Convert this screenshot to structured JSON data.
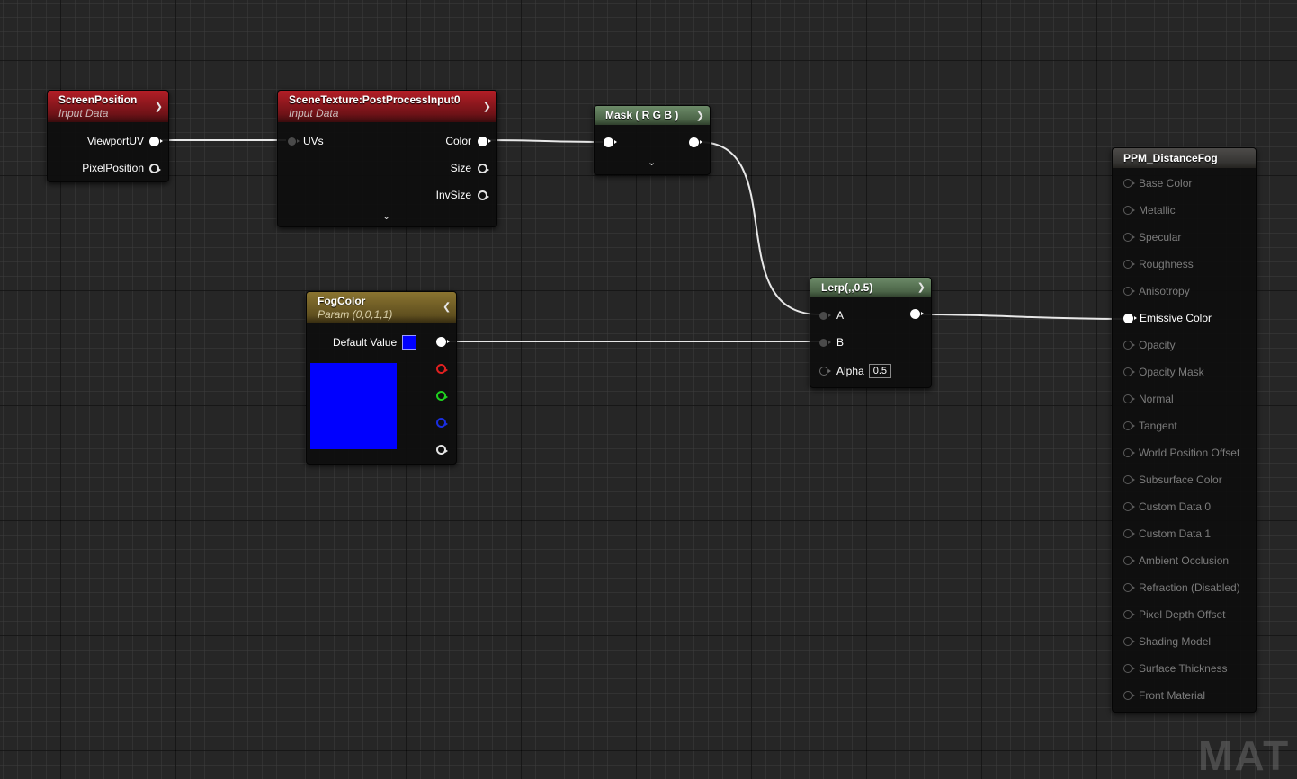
{
  "nodes": {
    "screen_position": {
      "title": "ScreenPosition",
      "subtitle": "Input Data",
      "outputs": [
        "ViewportUV",
        "PixelPosition"
      ]
    },
    "scene_texture": {
      "title": "SceneTexture:PostProcessInput0",
      "subtitle": "Input Data",
      "inputs": [
        "UVs"
      ],
      "outputs": [
        "Color",
        "Size",
        "InvSize"
      ]
    },
    "mask": {
      "title": "Mask ( R G B )"
    },
    "fog_color": {
      "title": "FogColor",
      "subtitle": "Param (0,0,1,1)",
      "default_label": "Default Value",
      "color": "#0000ff"
    },
    "lerp": {
      "title": "Lerp(,,0.5)",
      "inputs": [
        "A",
        "B",
        "Alpha"
      ],
      "alpha_value": "0.5"
    },
    "result": {
      "title": "PPM_DistanceFog",
      "active_pin": "Emissive Color",
      "pins": [
        "Base Color",
        "Metallic",
        "Specular",
        "Roughness",
        "Anisotropy",
        "Emissive Color",
        "Opacity",
        "Opacity Mask",
        "Normal",
        "Tangent",
        "World Position Offset",
        "Subsurface Color",
        "Custom Data 0",
        "Custom Data 1",
        "Ambient Occlusion",
        "Refraction (Disabled)",
        "Pixel Depth Offset",
        "Shading Model",
        "Surface Thickness",
        "Front Material"
      ]
    }
  },
  "colors": {
    "wire": "#e8e8e8",
    "background": "#262626",
    "pin_inactive_text": "#7b7b7b"
  },
  "icons": {
    "collapse": "chevron-down-icon",
    "expand": "chevron-up-icon"
  },
  "watermark": "MAT"
}
